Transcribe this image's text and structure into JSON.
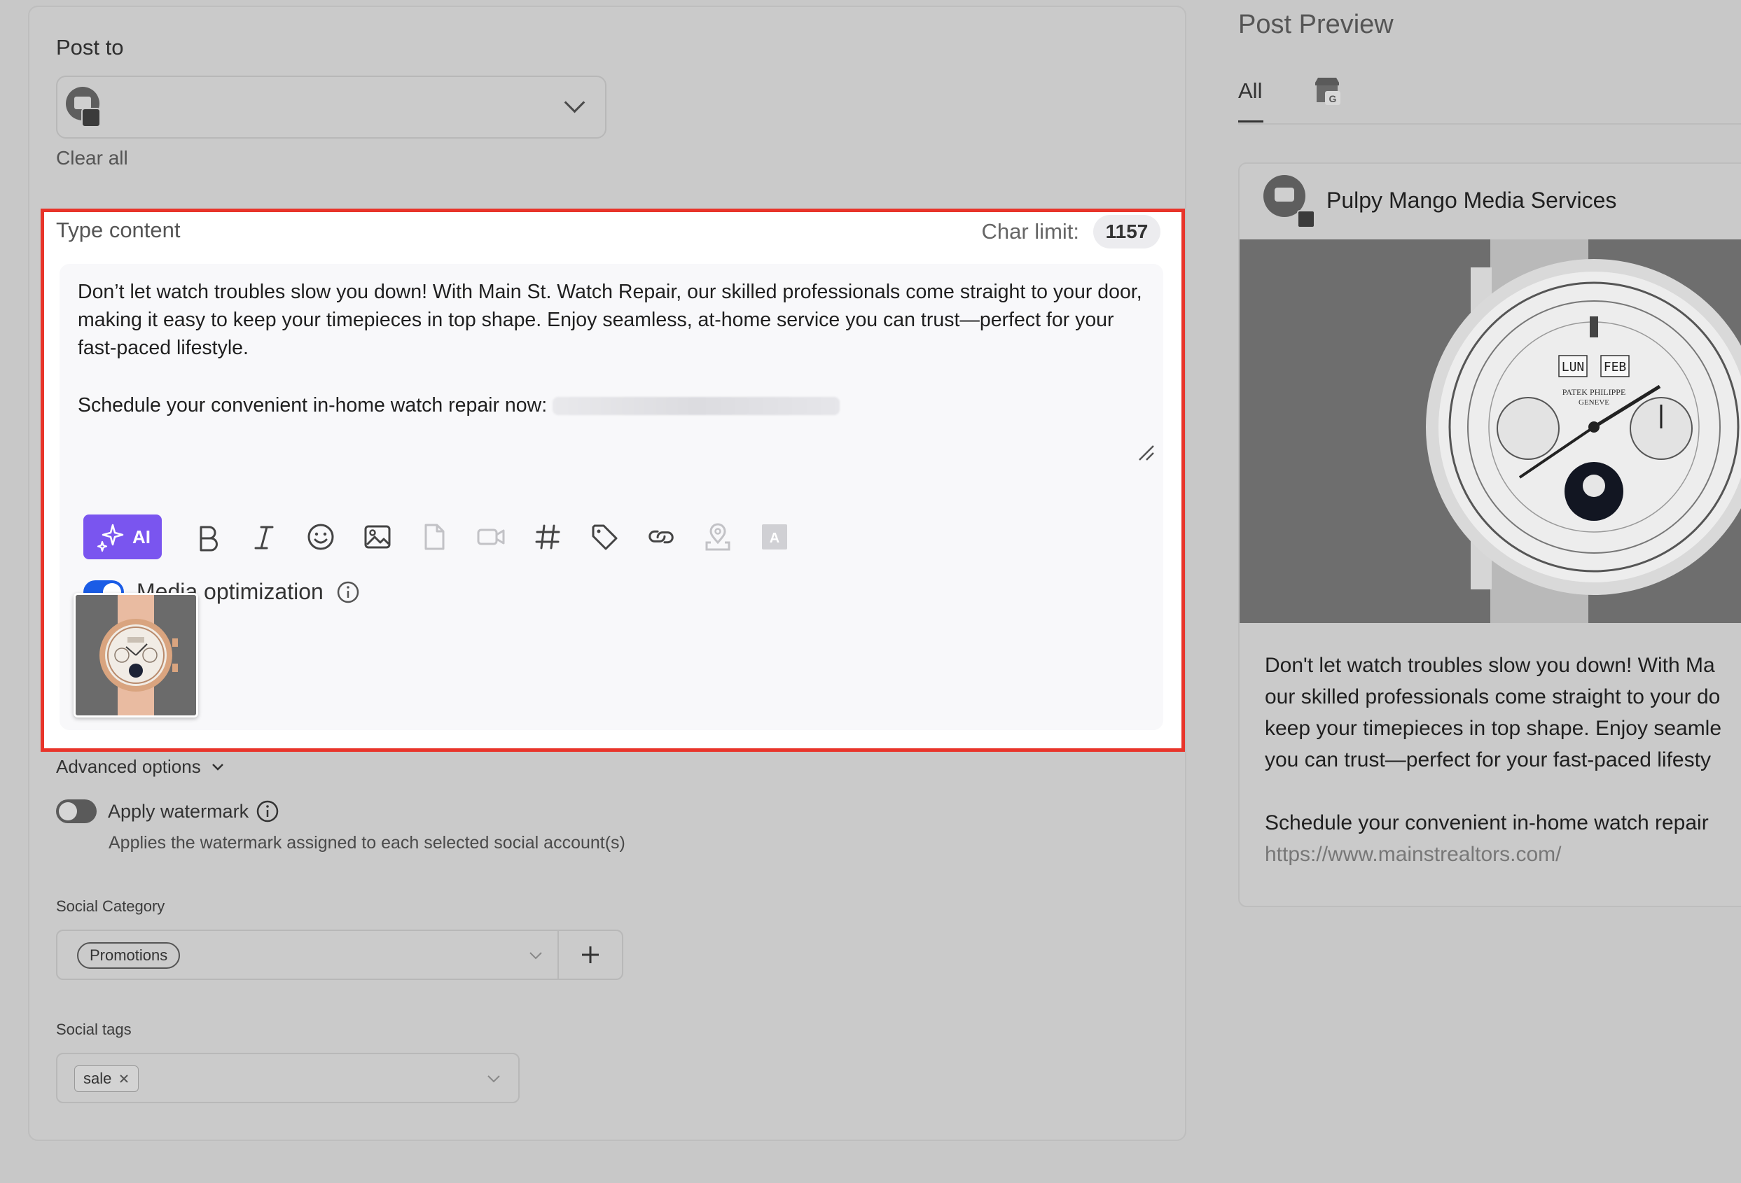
{
  "composer": {
    "post_to_label": "Post to",
    "clear_all": "Clear all",
    "type_content_label": "Type content",
    "char_limit_label": "Char limit:",
    "char_limit_value": "1157",
    "content_paragraph": "Don’t let watch troubles slow you down! With Main St. Watch Repair, our skilled professionals come straight to your door, making it easy to keep your timepieces in top shape. Enjoy seamless, at-home service you can trust—perfect for your fast-paced lifestyle.",
    "content_cta": "Schedule your convenient in-home watch repair now:",
    "ai_button": "AI",
    "toolbar_icons": [
      "bold-icon",
      "italic-icon",
      "emoji-icon",
      "image-icon",
      "document-icon",
      "video-icon",
      "hashtag-icon",
      "tag-icon",
      "link-icon",
      "location-icon",
      "text-style-icon"
    ],
    "media_optimization_label": "Media optimization",
    "media_optimization_on": true,
    "advanced_options": "Advanced options",
    "apply_watermark_label": "Apply watermark",
    "apply_watermark_on": false,
    "watermark_desc": "Applies the watermark assigned to each selected social account(s)",
    "social_category_label": "Social Category",
    "social_category_value": "Promotions",
    "social_tags_label": "Social tags",
    "social_tags": [
      "sale"
    ]
  },
  "preview": {
    "title": "Post Preview",
    "tab_all": "All",
    "account_name": "Pulpy Mango Media Services",
    "text_lines": [
      "Don't let watch troubles slow you down! With Ma",
      "our skilled professionals come straight to your do",
      "keep your timepieces in top shape. Enjoy seamle",
      "you can trust—perfect for your fast-paced lifesty"
    ],
    "cta_line": "Schedule your convenient in-home watch repair",
    "link": "https://www.mainstrealtors.com/"
  },
  "colors": {
    "accent_blue": "#1a5ce6",
    "ai_purple": "#7a55ef",
    "highlight_red": "#e8342a",
    "overlay_gray": "#c8c8c8"
  }
}
